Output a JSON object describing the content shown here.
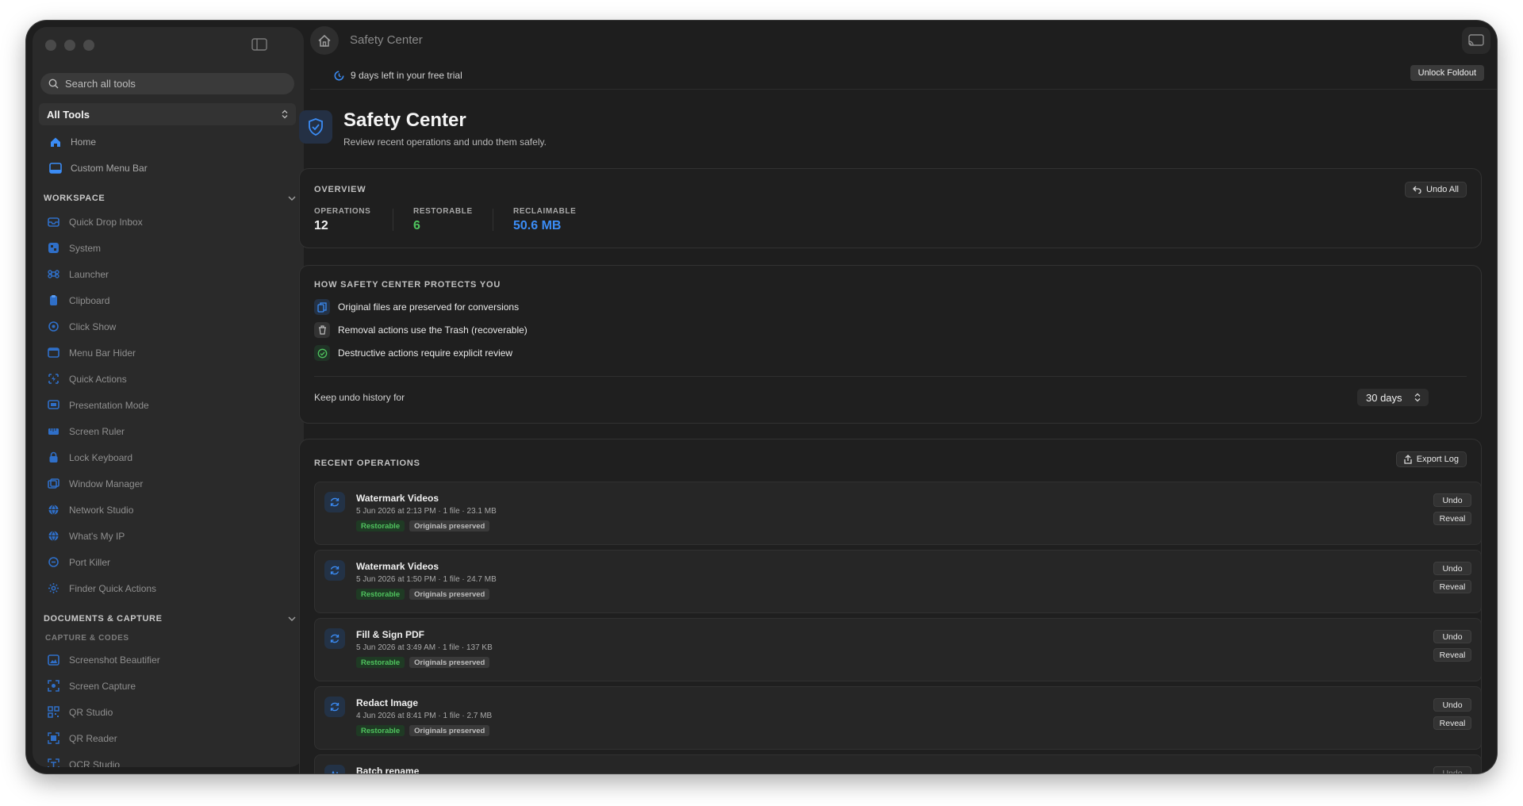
{
  "window": {
    "title": "Safety Center"
  },
  "sidebar": {
    "search_placeholder": "Search all tools",
    "tool_filter": "All Tools",
    "top_items": [
      {
        "label": "Home",
        "icon": "house-icon"
      },
      {
        "label": "Custom Menu Bar",
        "icon": "menubar-icon"
      }
    ],
    "workspace": {
      "title": "WORKSPACE",
      "items": [
        {
          "label": "Quick Drop Inbox",
          "icon": "inbox-icon"
        },
        {
          "label": "System",
          "icon": "system-icon"
        },
        {
          "label": "Launcher",
          "icon": "command-icon"
        },
        {
          "label": "Clipboard",
          "icon": "clipboard-icon"
        },
        {
          "label": "Click Show",
          "icon": "click-icon"
        },
        {
          "label": "Menu Bar Hider",
          "icon": "menubar-hider-icon"
        },
        {
          "label": "Quick Actions",
          "icon": "bolt-icon"
        },
        {
          "label": "Presentation Mode",
          "icon": "presentation-icon"
        },
        {
          "label": "Screen Ruler",
          "icon": "ruler-icon"
        },
        {
          "label": "Lock Keyboard",
          "icon": "lock-icon"
        },
        {
          "label": "Window Manager",
          "icon": "window-icon"
        },
        {
          "label": "Network Studio",
          "icon": "globe-icon"
        },
        {
          "label": "What's My IP",
          "icon": "globe-icon"
        },
        {
          "label": "Port Killer",
          "icon": "port-icon"
        },
        {
          "label": "Finder Quick Actions",
          "icon": "gear-icon"
        }
      ]
    },
    "documents": {
      "title": "DOCUMENTS & CAPTURE",
      "subtitle": "CAPTURE & CODES",
      "items": [
        {
          "label": "Screenshot Beautifier",
          "icon": "image-icon"
        },
        {
          "label": "Screen Capture",
          "icon": "capture-icon"
        },
        {
          "label": "QR Studio",
          "icon": "qr-icon"
        },
        {
          "label": "QR Reader",
          "icon": "qr-reader-icon"
        },
        {
          "label": "OCR Studio",
          "icon": "ocr-icon"
        }
      ]
    }
  },
  "trial": {
    "text": "9 days left in your free trial",
    "unlock_label": "Unlock Foldout"
  },
  "page": {
    "title": "Safety Center",
    "subtitle": "Review recent operations and undo them safely."
  },
  "overview": {
    "title": "OVERVIEW",
    "undo_all_label": "Undo All",
    "stats": [
      {
        "label": "OPERATIONS",
        "value": "12",
        "color": "#f0f0f0"
      },
      {
        "label": "RESTORABLE",
        "value": "6",
        "color": "#4fc35e"
      },
      {
        "label": "RECLAIMABLE",
        "value": "50.6 MB",
        "color": "#3b8cf5"
      }
    ]
  },
  "protect": {
    "title": "HOW SAFETY CENTER PROTECTS YOU",
    "items": [
      {
        "text": "Original files are preserved for conversions",
        "icon": "copy-icon"
      },
      {
        "text": "Removal actions use the Trash (recoverable)",
        "icon": "trash-icon"
      },
      {
        "text": "Destructive actions require explicit review",
        "icon": "check-circle-icon"
      }
    ],
    "history_label": "Keep undo history for",
    "history_value": "30 days"
  },
  "recent": {
    "title": "RECENT OPERATIONS",
    "export_label": "Export Log",
    "undo_label": "Undo",
    "reveal_label": "Reveal",
    "badge_restorable": "Restorable",
    "badge_preserved": "Originals preserved",
    "operations": [
      {
        "name": "Watermark Videos",
        "meta": "5 Jun 2026 at 2:13 PM · 1 file · 23.1 MB"
      },
      {
        "name": "Watermark Videos",
        "meta": "5 Jun 2026 at 1:50 PM · 1 file · 24.7 MB"
      },
      {
        "name": "Fill & Sign PDF",
        "meta": "5 Jun 2026 at 3:49 AM · 1 file · 137 KB"
      },
      {
        "name": "Redact Image",
        "meta": "4 Jun 2026 at 8:41 PM · 1 file · 2.7 MB"
      },
      {
        "name": "Batch rename",
        "meta": ""
      }
    ]
  },
  "colors": {
    "accent": "#3b8cf5",
    "green": "#4fc35e",
    "window_bg": "#1e1e1e",
    "sidebar_bg": "#2a2a2a"
  }
}
